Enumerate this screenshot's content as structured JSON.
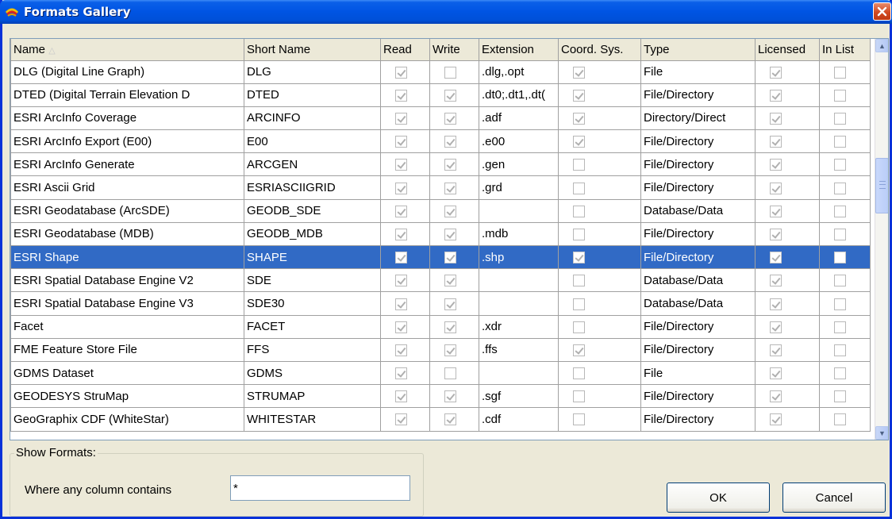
{
  "window": {
    "title": "Formats Gallery"
  },
  "grid": {
    "columns": [
      "Name",
      "Short Name",
      "Read",
      "Write",
      "Extension",
      "Coord. Sys.",
      "Type",
      "Licensed",
      "In List"
    ],
    "sort_indicator": "△",
    "rows": [
      {
        "name": "DLG (Digital Line Graph)",
        "short": "DLG",
        "read": true,
        "write": false,
        "ext": ".dlg,.opt",
        "coord": true,
        "type": "File",
        "licensed": true,
        "inlist": false
      },
      {
        "name": "DTED (Digital Terrain Elevation D",
        "short": "DTED",
        "read": true,
        "write": true,
        "ext": ".dt0;.dt1,.dt(",
        "coord": true,
        "type": "File/Directory",
        "licensed": true,
        "inlist": false
      },
      {
        "name": "ESRI ArcInfo Coverage",
        "short": "ARCINFO",
        "read": true,
        "write": true,
        "ext": ".adf",
        "coord": true,
        "type": "Directory/Direct",
        "licensed": true,
        "inlist": false
      },
      {
        "name": "ESRI ArcInfo Export (E00)",
        "short": "E00",
        "read": true,
        "write": true,
        "ext": ".e00",
        "coord": true,
        "type": "File/Directory",
        "licensed": true,
        "inlist": false
      },
      {
        "name": "ESRI ArcInfo Generate",
        "short": "ARCGEN",
        "read": true,
        "write": true,
        "ext": ".gen",
        "coord": false,
        "type": "File/Directory",
        "licensed": true,
        "inlist": false
      },
      {
        "name": "ESRI Ascii Grid",
        "short": "ESRIASCIIGRID",
        "read": true,
        "write": true,
        "ext": ".grd",
        "coord": false,
        "type": "File/Directory",
        "licensed": true,
        "inlist": false
      },
      {
        "name": "ESRI Geodatabase (ArcSDE)",
        "short": "GEODB_SDE",
        "read": true,
        "write": true,
        "ext": "",
        "coord": false,
        "type": "Database/Data",
        "licensed": true,
        "inlist": false
      },
      {
        "name": "ESRI Geodatabase (MDB)",
        "short": "GEODB_MDB",
        "read": true,
        "write": true,
        "ext": ".mdb",
        "coord": false,
        "type": "File/Directory",
        "licensed": true,
        "inlist": false
      },
      {
        "name": "ESRI Shape",
        "short": "SHAPE",
        "read": true,
        "write": true,
        "ext": ".shp",
        "coord": true,
        "type": "File/Directory",
        "licensed": true,
        "inlist": false,
        "selected": true
      },
      {
        "name": "ESRI Spatial Database Engine V2",
        "short": "SDE",
        "read": true,
        "write": true,
        "ext": "",
        "coord": false,
        "type": "Database/Data",
        "licensed": true,
        "inlist": false
      },
      {
        "name": "ESRI Spatial Database Engine V3",
        "short": "SDE30",
        "read": true,
        "write": true,
        "ext": "",
        "coord": false,
        "type": "Database/Data",
        "licensed": true,
        "inlist": false
      },
      {
        "name": "Facet",
        "short": "FACET",
        "read": true,
        "write": true,
        "ext": ".xdr",
        "coord": false,
        "type": "File/Directory",
        "licensed": true,
        "inlist": false
      },
      {
        "name": "FME Feature Store File",
        "short": "FFS",
        "read": true,
        "write": true,
        "ext": ".ffs",
        "coord": true,
        "type": "File/Directory",
        "licensed": true,
        "inlist": false
      },
      {
        "name": "GDMS Dataset",
        "short": "GDMS",
        "read": true,
        "write": false,
        "ext": "",
        "coord": false,
        "type": "File",
        "licensed": true,
        "inlist": false
      },
      {
        "name": "GEODESYS StruMap",
        "short": "STRUMAP",
        "read": true,
        "write": true,
        "ext": ".sgf",
        "coord": false,
        "type": "File/Directory",
        "licensed": true,
        "inlist": false
      },
      {
        "name": "GeoGraphix CDF (WhiteStar)",
        "short": "WHITESTAR",
        "read": true,
        "write": true,
        "ext": ".cdf",
        "coord": false,
        "type": "File/Directory",
        "licensed": true,
        "inlist": false
      }
    ]
  },
  "filter": {
    "group_label": "Show Formats:",
    "label": "Where any column contains",
    "value": "*"
  },
  "buttons": {
    "ok": "OK",
    "cancel": "Cancel"
  },
  "colors": {
    "titlebar": "#0054e3",
    "selection": "#316ac5",
    "close": "#d24a22"
  }
}
